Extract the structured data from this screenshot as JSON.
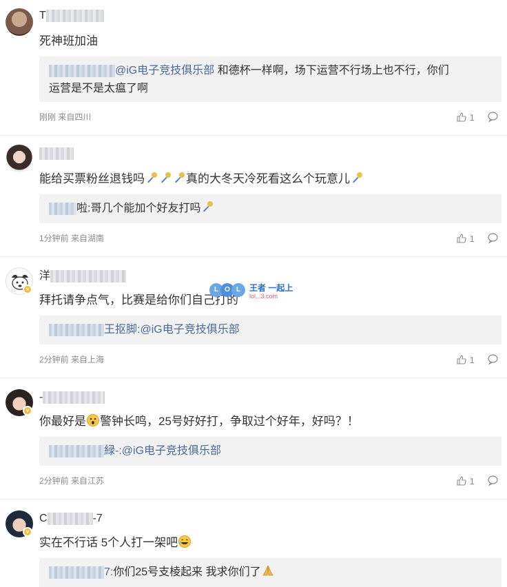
{
  "comments": [
    {
      "username_visible": "T",
      "text": "死神班加油",
      "reply_prefix": "",
      "reply_at": "@iG电子竞技俱乐部",
      "reply_line1": " 和德杯一样啊，场下运营不行场上也不行，你们",
      "reply_line2": "运营是不是太瘟了啊",
      "meta": "刚刚 来自四川",
      "likes": "1"
    },
    {
      "username_visible": "",
      "text_a": "能给买票粉丝退钱吗",
      "text_b": "真的大冬天冷死看这么个玩意儿",
      "reply_prefix": "啦",
      "reply_text": "哥几个能加个好友打吗",
      "meta": "1分钟前 来自湖南",
      "likes": "1"
    },
    {
      "username_visible": "洋",
      "text": "拜托请争点气，比赛是给你们自己打的",
      "reply_prefix": "王抠脚:",
      "reply_at": "@iG电子竞技俱乐部",
      "meta": "2分钟前 来自上海",
      "likes": "1"
    },
    {
      "username_visible": "-",
      "text_a": "你最好是",
      "text_b": "警钟长鸣，25号好好打，争取过个好年，好吗？！",
      "reply_prefix": "緑-:",
      "reply_at": "@iG电子竞技俱乐部",
      "meta": "2分钟前 来自江苏",
      "likes": "1"
    },
    {
      "username_visible_a": "C",
      "username_visible_b": "-7",
      "text": "实在不行话 5个人打一架吧",
      "reply_prefix": "7:",
      "reply_text": "你们25号支棱起来 我求你们了",
      "meta": "",
      "likes": ""
    }
  ],
  "watermark": {
    "brand": "王者 一起上",
    "site": "lol...3.com",
    "ball_letters": [
      "L",
      "O",
      "L"
    ]
  },
  "icons": {
    "like": "thumbs-up-icon",
    "comment": "comment-bubble-icon",
    "verified": "verified-badge-icon",
    "emoji_mic": "microphone-emoji-icon",
    "emoji_shock": "shocked-face-emoji-icon",
    "emoji_laugh": "laughing-face-emoji-icon",
    "emoji_pray": "praying-hands-emoji-icon"
  },
  "colors": {
    "link": "#4a6b9a",
    "reply_bg": "#f2f2f3",
    "meta": "#8a8a8a",
    "verified": "#f6b93b"
  }
}
